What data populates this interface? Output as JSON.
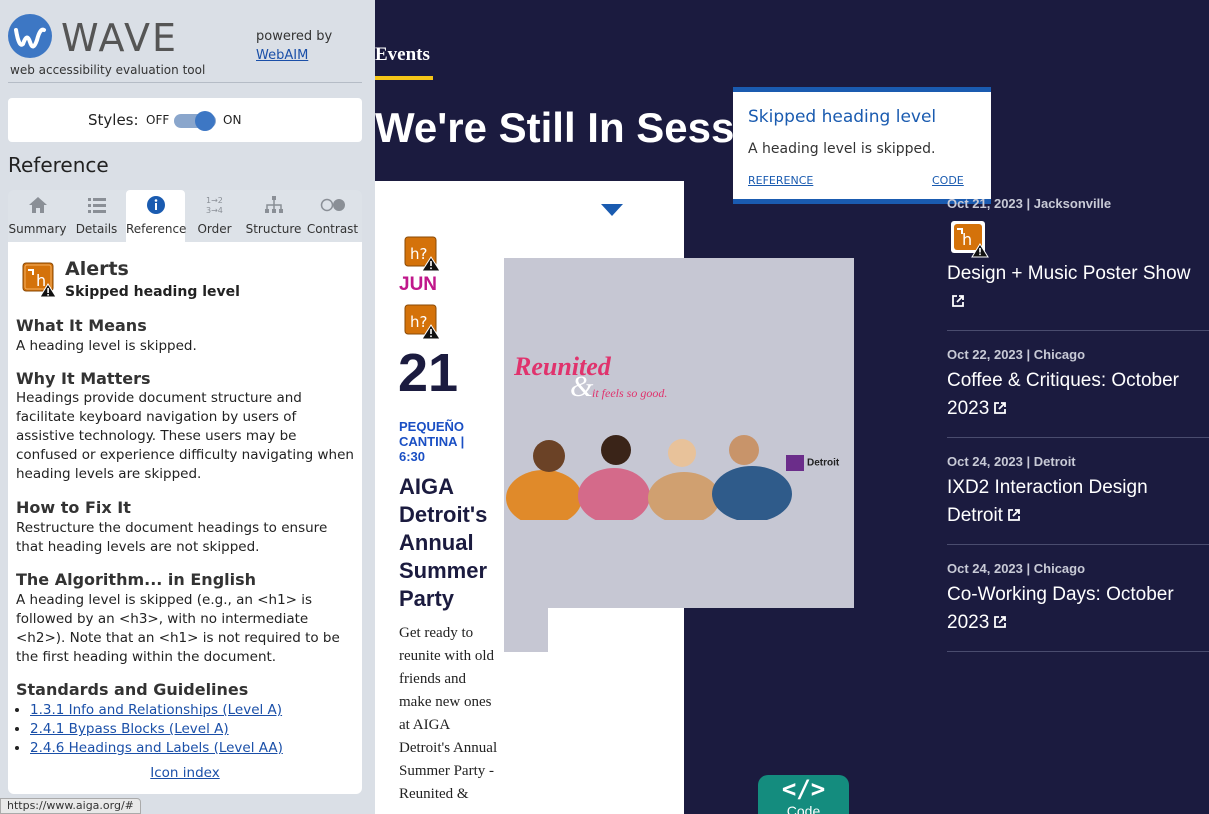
{
  "wave": {
    "logo_text": "WAVE",
    "logo_sub": "web accessibility evaluation tool",
    "powered_by": "powered by",
    "webaim_link": "WebAIM",
    "styles_label": "Styles:",
    "off_label": "OFF",
    "on_label": "ON",
    "styles_on": true,
    "reference_heading": "Reference",
    "tabs": [
      {
        "label": "Summary",
        "icon": "home-icon"
      },
      {
        "label": "Details",
        "icon": "list-icon"
      },
      {
        "label": "Reference",
        "icon": "info-icon",
        "active": true
      },
      {
        "label": "Order",
        "icon": "order-icon"
      },
      {
        "label": "Structure",
        "icon": "structure-icon"
      },
      {
        "label": "Contrast",
        "icon": "contrast-icon"
      }
    ],
    "alerts_title": "Alerts",
    "alert_name": "Skipped heading level",
    "what_heading": "What It Means",
    "what_text": "A heading level is skipped.",
    "why_heading": "Why It Matters",
    "why_text": "Headings provide document structure and facilitate keyboard navigation by users of assistive technology. These users may be confused or experience difficulty navigating when heading levels are skipped.",
    "fix_heading": "How to Fix It",
    "fix_text": "Restructure the document headings to ensure that heading levels are not skipped.",
    "algo_heading": "The Algorithm... in English",
    "algo_text": "A heading level is skipped (e.g., an <h1> is followed by an <h3>, with no intermediate <h2>). Note that an <h1> is not required to be the first heading within the document.",
    "standards_heading": "Standards and Guidelines",
    "standards": [
      "1.3.1 Info and Relationships (Level A)",
      "2.4.1 Bypass Blocks (Level A)",
      "2.4.6 Headings and Labels (Level AA)"
    ],
    "icon_index": "Icon index",
    "status_url": "https://www.aiga.org/#"
  },
  "page": {
    "events_tab": "Events",
    "title": "We're Still In Session",
    "featured": {
      "month": "JUN",
      "day": "21",
      "venue": "PEQUEÑO CANTINA | 6:30",
      "name": "AIGA Detroit's Annual Summer Party",
      "description": "Get ready to reunite with old friends and make new ones at AIGA Detroit's Annual Summer Party - Reunited &",
      "poster_title": "Reunited",
      "poster_amp": "&",
      "poster_sub": "it feels so good.",
      "poster_brand": "Detroit"
    },
    "popup": {
      "title": "Skipped heading level",
      "description": "A heading level is skipped.",
      "reference": "REFERENCE",
      "code": "CODE"
    },
    "events": [
      {
        "meta": "Oct 21, 2023 | Jacksonville",
        "title": "Design + Music Poster Show"
      },
      {
        "meta": "Oct 22, 2023 | Chicago",
        "title": "Coffee & Critiques: October 2023"
      },
      {
        "meta": "Oct 24, 2023 | Detroit",
        "title": "IXD2 Interaction Design Detroit"
      },
      {
        "meta": "Oct 24, 2023 | Chicago",
        "title": "Co-Working Days: October 2023"
      }
    ],
    "code_glyph": "</>",
    "code_label": "Code"
  },
  "colors": {
    "page_bg": "#1b1b3f",
    "accent_yellow": "#f5c518",
    "wave_blue": "#3d77c4",
    "alert_orange": "#d4720a",
    "code_teal": "#148c7e",
    "magenta": "#c0178b"
  }
}
